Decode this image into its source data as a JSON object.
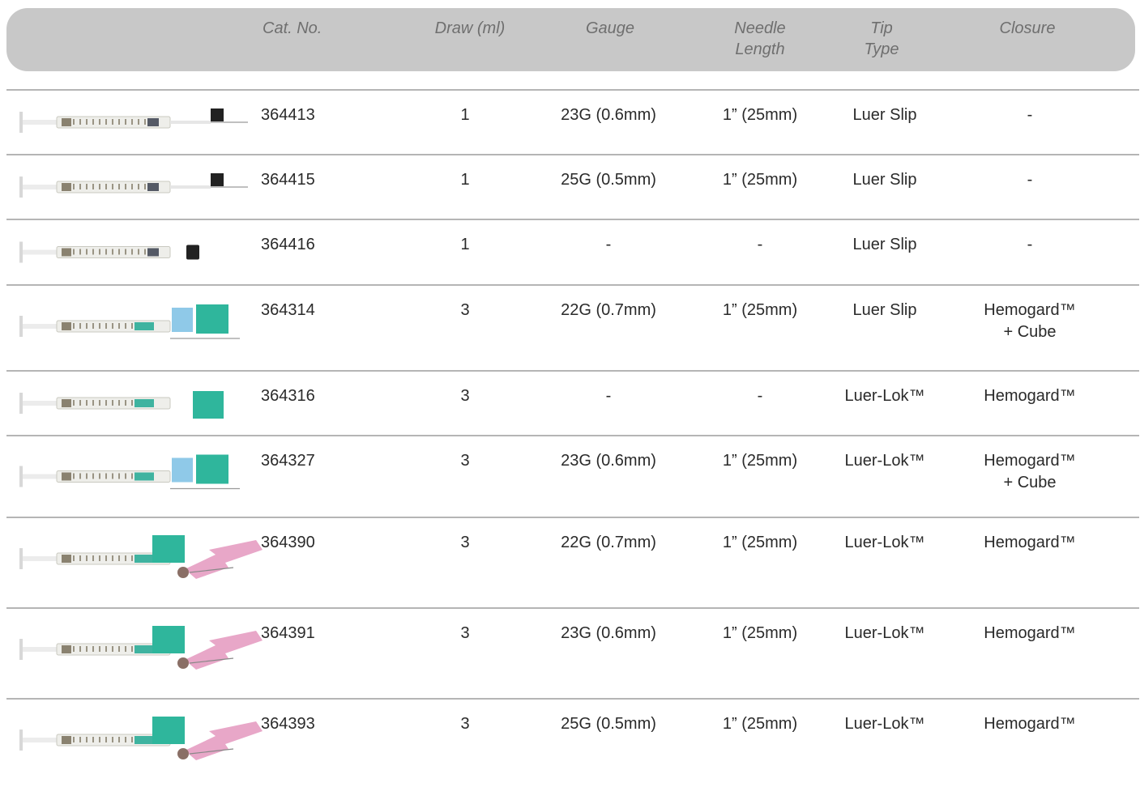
{
  "header": {
    "cat_no": "Cat. No.",
    "draw": "Draw (ml)",
    "gauge": "Gauge",
    "needle_length_1": "Needle",
    "needle_length_2": "Length",
    "tip_type_1": "Tip",
    "tip_type_2": "Type",
    "closure": "Closure"
  },
  "rows": [
    {
      "cat": "364413",
      "draw": "1",
      "gauge": "23G (0.6mm)",
      "length": "1” (25mm)",
      "tip": "Luer Slip",
      "closure_1": "-",
      "closure_2": "",
      "image": "syringe-with-needle-icon"
    },
    {
      "cat": "364415",
      "draw": "1",
      "gauge": "25G (0.5mm)",
      "length": "1” (25mm)",
      "tip": "Luer Slip",
      "closure_1": "-",
      "closure_2": "",
      "image": "syringe-with-needle-icon"
    },
    {
      "cat": "364416",
      "draw": "1",
      "gauge": "-",
      "length": "-",
      "tip": "Luer Slip",
      "closure_1": "-",
      "closure_2": "",
      "image": "syringe-icon"
    },
    {
      "cat": "364314",
      "draw": "3",
      "gauge": "22G (0.7mm)",
      "length": "1” (25mm)",
      "tip": "Luer Slip",
      "closure_1": "Hemogard™",
      "closure_2": "+ Cube",
      "image": "syringe-with-cube-icon"
    },
    {
      "cat": "364316",
      "draw": "3",
      "gauge": "-",
      "length": "-",
      "tip": "Luer-Lok™",
      "closure_1": "Hemogard™",
      "closure_2": "",
      "image": "syringe-with-cap-icon"
    },
    {
      "cat": "364327",
      "draw": "3",
      "gauge": "23G (0.6mm)",
      "length": "1” (25mm)",
      "tip": "Luer-Lok™",
      "closure_1": "Hemogard™",
      "closure_2": "+ Cube",
      "image": "syringe-with-cube-icon"
    },
    {
      "cat": "364390",
      "draw": "3",
      "gauge": "22G (0.7mm)",
      "length": "1” (25mm)",
      "tip": "Luer-Lok™",
      "closure_1": "Hemogard™",
      "closure_2": "",
      "image": "safety-syringe-icon"
    },
    {
      "cat": "364391",
      "draw": "3",
      "gauge": "23G (0.6mm)",
      "length": "1” (25mm)",
      "tip": "Luer-Lok™",
      "closure_1": "Hemogard™",
      "closure_2": "",
      "image": "safety-syringe-icon"
    },
    {
      "cat": "364393",
      "draw": "3",
      "gauge": "25G (0.5mm)",
      "length": "1” (25mm)",
      "tip": "Luer-Lok™",
      "closure_1": "Hemogard™",
      "closure_2": "",
      "image": "safety-syringe-icon"
    }
  ]
}
